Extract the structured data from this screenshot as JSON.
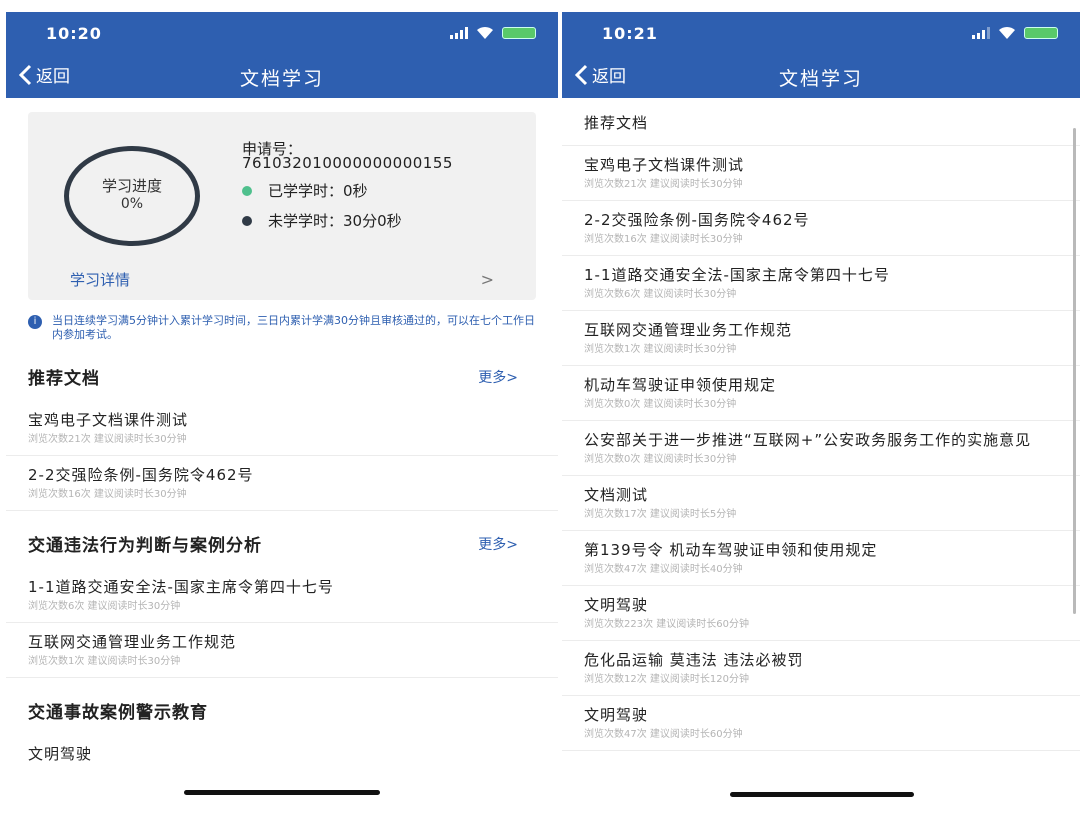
{
  "left": {
    "status_time": "10:20",
    "back_label": "返回",
    "title": "文档学习",
    "progress": {
      "label": "学习进度",
      "percent": "0%",
      "application_label": "申请号：",
      "application_number": "761032010000000000155",
      "learned": "已学学时：0秒",
      "unlearned": "未学学时：30分0秒",
      "detail_label": "学习详情",
      "learned_color": "#4fc08d",
      "unlearned_color": "#303a46"
    },
    "notice": "当日连续学习满5分钟计入累计学习时间，三日内累计学满30分钟且审核通过的，可以在七个工作日内参加考试。",
    "sections": [
      {
        "title": "推荐文档",
        "more": "更多>",
        "items": [
          {
            "title": "宝鸡电子文档课件测试",
            "meta": "浏览次数21次  建议阅读时长30分钟"
          },
          {
            "title": "2-2交强险条例-国务院令462号",
            "meta": "浏览次数16次  建议阅读时长30分钟"
          }
        ]
      },
      {
        "title": "交通违法行为判断与案例分析",
        "more": "更多>",
        "items": [
          {
            "title": "1-1道路交通安全法-国家主席令第四十七号",
            "meta": "浏览次数6次  建议阅读时长30分钟"
          },
          {
            "title": "互联网交通管理业务工作规范",
            "meta": "浏览次数1次  建议阅读时长30分钟"
          }
        ]
      },
      {
        "title": "交通事故案例警示教育",
        "more": "",
        "items": [
          {
            "title": "文明驾驶",
            "meta": ""
          }
        ]
      }
    ]
  },
  "right": {
    "status_time": "10:21",
    "back_label": "返回",
    "title": "文档学习",
    "section_title": "推荐文档",
    "items": [
      {
        "title": "宝鸡电子文档课件测试",
        "meta": "浏览次数21次  建议阅读时长30分钟"
      },
      {
        "title": "2-2交强险条例-国务院令462号",
        "meta": "浏览次数16次  建议阅读时长30分钟"
      },
      {
        "title": "1-1道路交通安全法-国家主席令第四十七号",
        "meta": "浏览次数6次  建议阅读时长30分钟"
      },
      {
        "title": "互联网交通管理业务工作规范",
        "meta": "浏览次数1次  建议阅读时长30分钟"
      },
      {
        "title": "机动车驾驶证申领使用规定",
        "meta": "浏览次数0次  建议阅读时长30分钟"
      },
      {
        "title": "公安部关于进一步推进“互联网+”公安政务服务工作的实施意见",
        "meta": "浏览次数0次  建议阅读时长30分钟"
      },
      {
        "title": "文档测试",
        "meta": "浏览次数17次  建议阅读时长5分钟"
      },
      {
        "title": "第139号令 机动车驾驶证申领和使用规定",
        "meta": "浏览次数47次  建议阅读时长40分钟"
      },
      {
        "title": "文明驾驶",
        "meta": "浏览次数223次  建议阅读时长60分钟"
      },
      {
        "title": "危化品运输 莫违法 违法必被罚",
        "meta": "浏览次数12次  建议阅读时长120分钟"
      },
      {
        "title": "文明驾驶",
        "meta": "浏览次数47次  建议阅读时长60分钟"
      }
    ]
  },
  "theme": {
    "header_color": "#2e5fb0",
    "accent_color": "#2e5fb0"
  }
}
